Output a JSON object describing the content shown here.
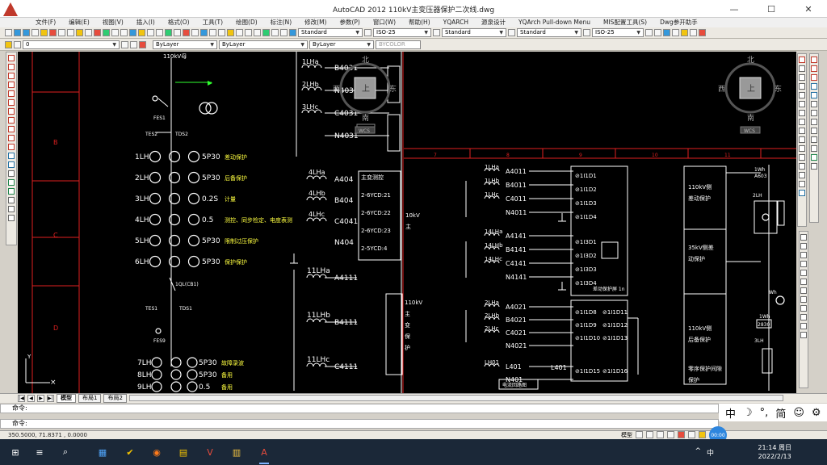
{
  "window": {
    "title": "AutoCAD 2012     110kV主变压器保护二次线.dwg",
    "minimize": "—",
    "maximize": "☐",
    "close": "✕"
  },
  "menu": [
    "文件(F)",
    "编辑(E)",
    "视图(V)",
    "插入(I)",
    "格式(O)",
    "工具(T)",
    "绘图(D)",
    "标注(N)",
    "修改(M)",
    "参数(P)",
    "窗口(W)",
    "帮助(H)",
    "YQARCH",
    "源泉设计",
    "YQArch Pull-down Menu",
    "MIS配置工具(S)",
    "Dwg参开助手"
  ],
  "toolbar": {
    "text_style": "Standard",
    "dim_style": "ISO-25",
    "table_style": "Standard",
    "multileader_style": "Standard",
    "dim_style_2": "ISO-25",
    "layer": "0",
    "color": "ByLayer",
    "linetype": "ByLayer",
    "lineweight": "ByLayer",
    "plotstyle": "BYCOLOR"
  },
  "layout_tabs": [
    "模型",
    "布局1",
    "布局2"
  ],
  "command_lines": [
    "命令:",
    "命令:"
  ],
  "status": {
    "coords": "350.5000,   71.8371 , 0.0000",
    "model": "模型"
  },
  "viewcube": {
    "top": "上",
    "north": "北",
    "south": "南",
    "east": "东",
    "west": "西",
    "wcs": "WCS"
  },
  "ime": {
    "lang": "中",
    "moon": "☽",
    "punct": "°,",
    "simp": "简",
    "smile": "☺",
    "gear": "⚙",
    "badge": "00:00"
  },
  "clock": {
    "time": "21:14 周日",
    "date": "2022/2/13"
  },
  "tray": {
    "chevron": "^",
    "input": "中"
  },
  "taskbar_icons": [
    "⊞",
    "≡",
    "⌕",
    "▦",
    "✔",
    "◉",
    "▤",
    "V",
    "▥",
    "A"
  ],
  "drawing": {
    "left_header": "110kV母",
    "left_rows": [
      {
        "label": "1LH",
        "spec": "5P30",
        "desc": "差动保护"
      },
      {
        "label": "2LH",
        "spec": "5P30",
        "desc": "后备保护"
      },
      {
        "label": "3LH",
        "spec": "0.2S",
        "desc": "计量"
      },
      {
        "label": "4LH",
        "spec": "0.5",
        "desc": "测控、同步检定、电度表测"
      },
      {
        "label": "5LH",
        "spec": "5P30",
        "desc": "限制过压保护"
      },
      {
        "label": "6LH",
        "spec": "5P30",
        "desc": "保护保护"
      }
    ],
    "bottom_rows": [
      {
        "label": "7LH",
        "spec": "5P30",
        "desc": "故障录波"
      },
      {
        "label": "8LH",
        "spec": "5P30",
        "desc": "备用"
      },
      {
        "label": "9LH",
        "spec": "0.5",
        "desc": "备用"
      }
    ],
    "left_small": [
      "FES1",
      "TES2",
      "TDS2",
      "1QL(CB1)",
      "TES1",
      "TDS1",
      "FES9"
    ],
    "frame_letters": [
      "B",
      "C",
      "D"
    ],
    "mid_coils": [
      {
        "name": "1LHa",
        "node": "B4031"
      },
      {
        "name": "2LHb",
        "node": "N4031"
      },
      {
        "name": "3LHc",
        "node": "C4031"
      },
      {
        "name": "",
        "node": "N4031"
      }
    ],
    "mid_coils2": [
      {
        "name": "4LHa",
        "node": "A404"
      },
      {
        "name": "4LHb",
        "node": "B404"
      },
      {
        "name": "4LHc",
        "node": "C4041"
      },
      {
        "name": "",
        "node": "N404"
      }
    ],
    "mid_coils3": [
      {
        "name": "11LHa",
        "node": "A4111"
      },
      {
        "name": "11LHb",
        "node": "B4111"
      },
      {
        "name": "11LHc",
        "node": "C4111"
      }
    ],
    "mid_box": [
      "主变测控",
      "2-6YCD:21",
      "2-6YCD:22",
      "2-6YCD:23",
      "2-5YCD:4"
    ],
    "ruler_nums": [
      "7",
      "8",
      "9",
      "10",
      "11"
    ],
    "right_coils_top": [
      {
        "name": "1LHa",
        "node": "A4011"
      },
      {
        "name": "1LHb",
        "node": "B4011"
      },
      {
        "name": "1LHc",
        "node": "C4011"
      },
      {
        "name": "",
        "node": "N4011"
      }
    ],
    "right_coils_mid": [
      {
        "name": "14LHa",
        "node": "A4141"
      },
      {
        "name": "14LHb",
        "node": "B4141"
      },
      {
        "name": "14LHc",
        "node": "C4141"
      },
      {
        "name": "",
        "node": "N4141"
      }
    ],
    "right_coils_low": [
      {
        "name": "2LHa",
        "node": "A4021"
      },
      {
        "name": "2LHb",
        "node": "B4021"
      },
      {
        "name": "2LHc",
        "node": "C4021"
      },
      {
        "name": "",
        "node": "N4021"
      }
    ],
    "right_coils_bot": [
      {
        "name": "LH01",
        "node": "L401"
      },
      {
        "name": "",
        "node": "N401"
      }
    ],
    "terms_top": [
      "1I1D1",
      "1I1D2",
      "1I1D3",
      "1I1D4"
    ],
    "terms_mid": [
      "1I3D1",
      "1I3D2",
      "1I3D3",
      "1I3D4"
    ],
    "terms_low": [
      "1I1D8",
      "1I1D9",
      "1I1D10",
      "1I1D11",
      "1I1D12",
      "1I1D13"
    ],
    "term_last": [
      "1I1D15",
      "1I1D16"
    ],
    "mid_caption": "差动保护屏 1n",
    "bottom_caption": "电流回路图",
    "right_labels": [
      "110kV侧差动保护",
      "35kV侧差动保护",
      "110kV侧后备保护",
      "零序保护间隙保护"
    ],
    "far_right": [
      "1Wh",
      "A603",
      "2LH",
      "Wh",
      "1Wh",
      "2830",
      "3LH"
    ],
    "left_110": [
      "110kV",
      "主",
      "变",
      "保",
      "护"
    ],
    "left_110b": [
      "110kV",
      "侧",
      "后",
      "备",
      "保"
    ],
    "left_35": [
      "10kV",
      "主"
    ],
    "L401": "L401"
  }
}
